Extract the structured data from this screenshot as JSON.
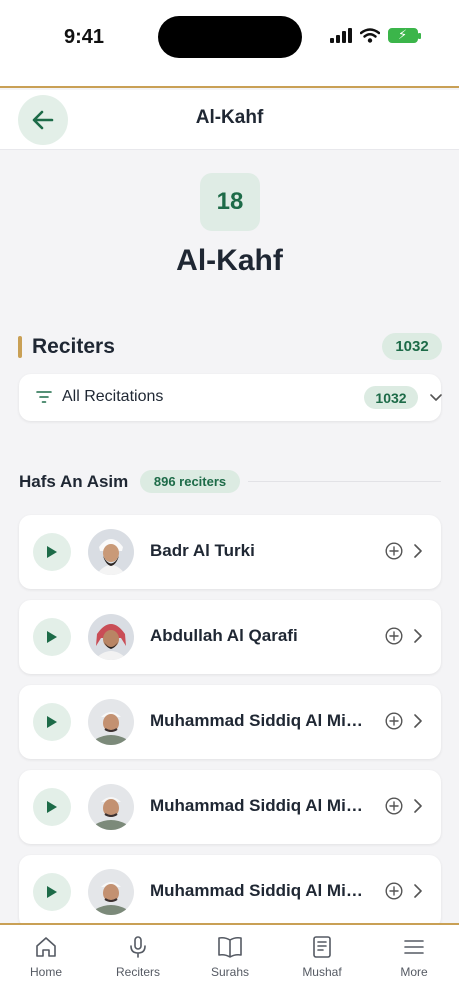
{
  "status": {
    "time": "9:41"
  },
  "header": {
    "title": "Al-Kahf"
  },
  "surah": {
    "number": "18",
    "name": "Al-Kahf"
  },
  "reciters_section": {
    "title": "Reciters",
    "count": "1032"
  },
  "filter": {
    "label": "All Recitations",
    "count": "1032"
  },
  "group": {
    "title": "Hafs An Asim",
    "badge": "896 reciters"
  },
  "reciters": [
    {
      "name": "Badr Al Turki"
    },
    {
      "name": "Abdullah Al Qarafi"
    },
    {
      "name": "Muhammad Siddiq Al Minshawi"
    },
    {
      "name": "Muhammad Siddiq Al Minshawi"
    },
    {
      "name": "Muhammad Siddiq Al Minshawi"
    }
  ],
  "tabs": [
    {
      "label": "Home",
      "icon": "home-icon"
    },
    {
      "label": "Reciters",
      "icon": "microphone-icon"
    },
    {
      "label": "Surahs",
      "icon": "book-open-icon"
    },
    {
      "label": "Mushaf",
      "icon": "document-icon"
    },
    {
      "label": "More",
      "icon": "menu-icon"
    }
  ],
  "colors": {
    "accent": "#1d6b48",
    "gold": "#c9a055",
    "badge_bg": "#dcebe2"
  }
}
